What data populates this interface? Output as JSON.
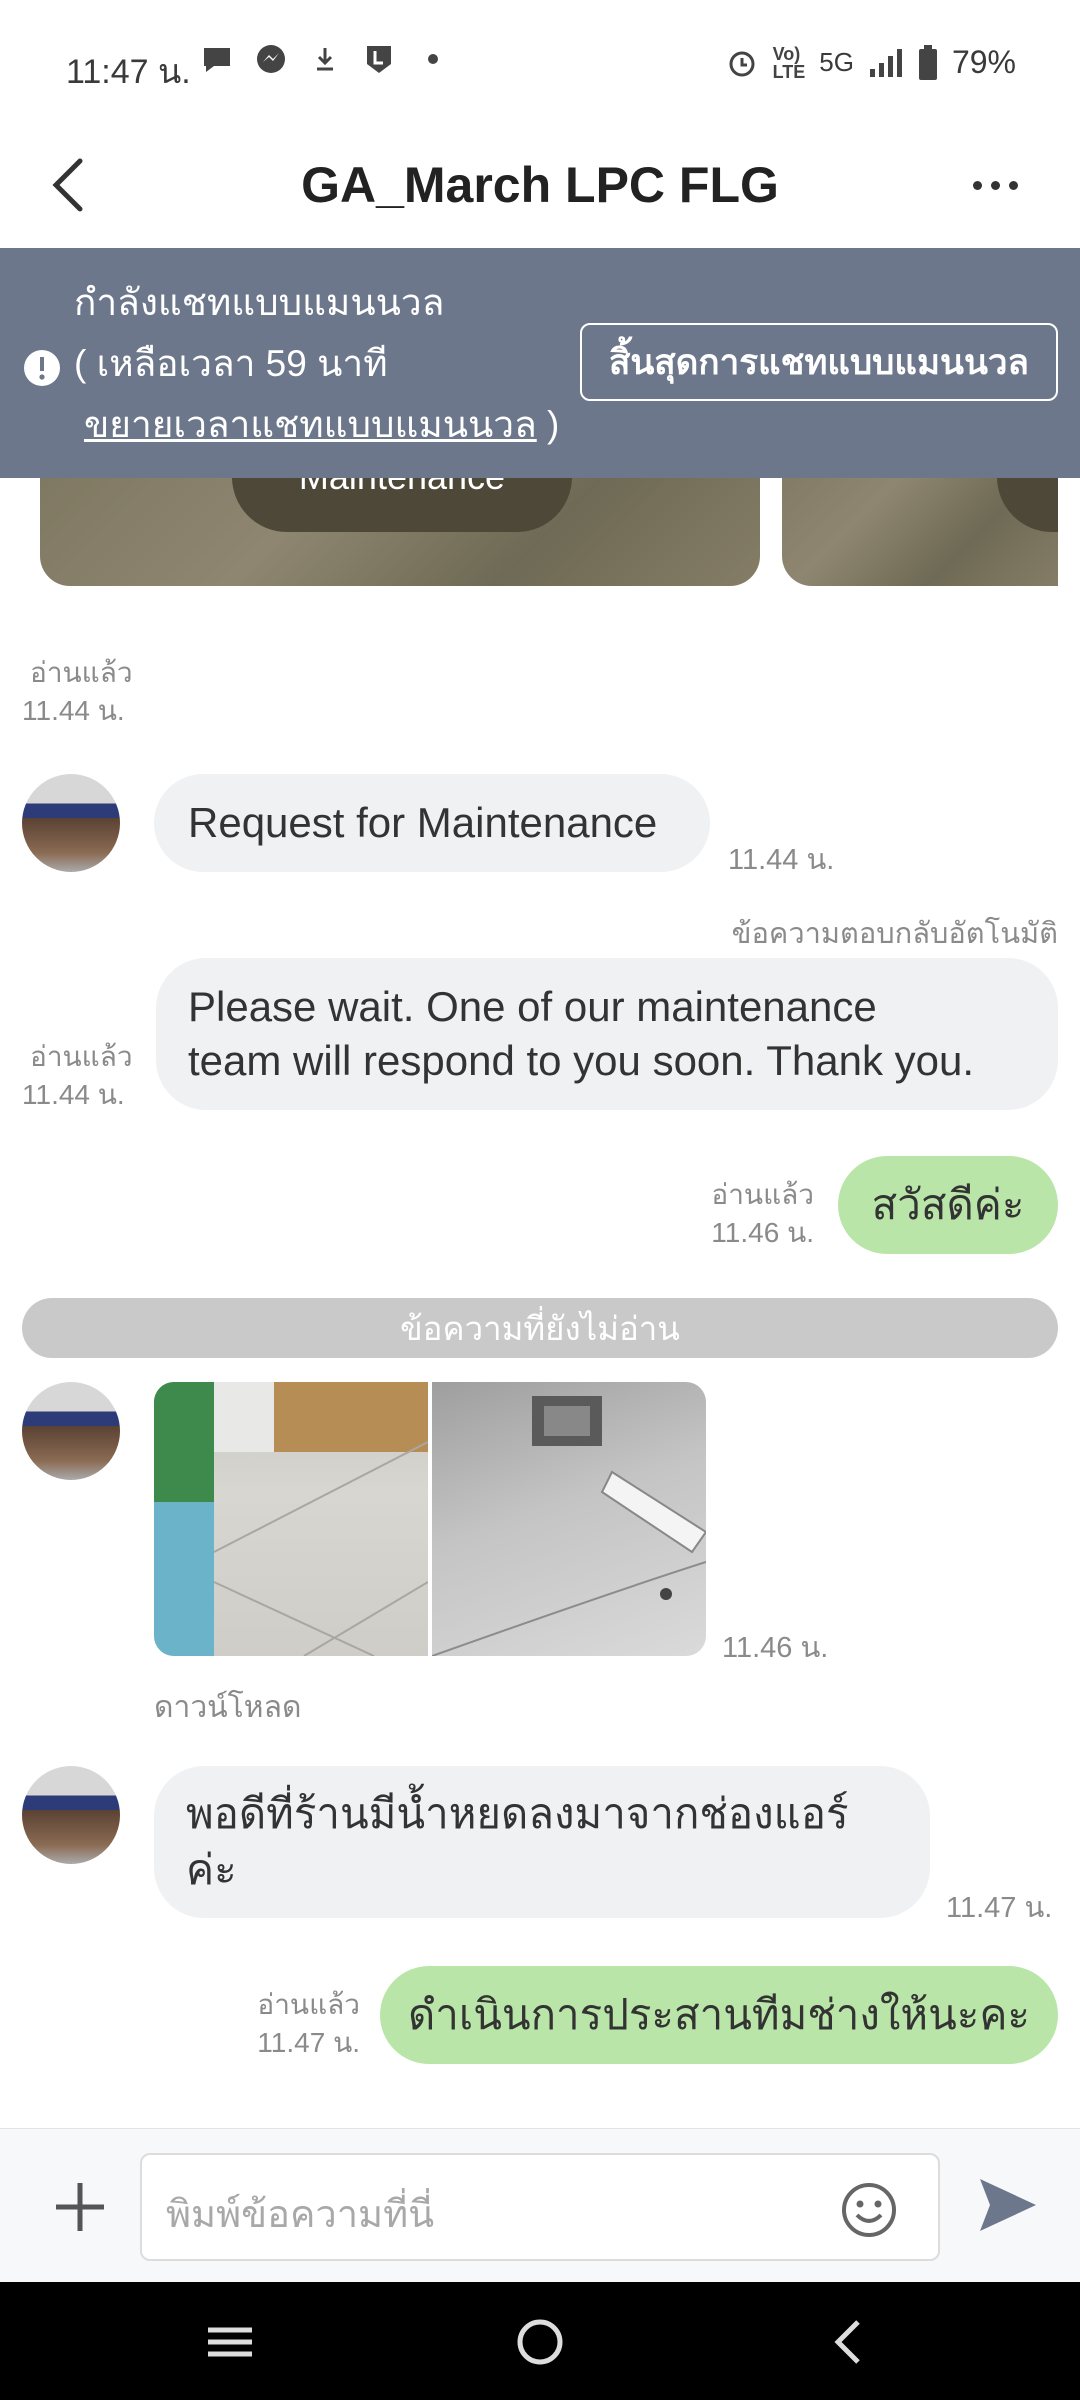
{
  "status_bar": {
    "time": "11:47 น.",
    "signal_text": "5G",
    "battery": "79%"
  },
  "header": {
    "title": "GA_March LPC FLG"
  },
  "banner": {
    "line1": "กำลังแชทแบบแมนนวล",
    "line2": "( เหลือเวลา 59 นาที",
    "link": "ขยายเวลาแชทแบบแมนนวล",
    "line3_suffix": " )",
    "end_button": "สิ้นสุดการแชทแบบแมนนวล"
  },
  "carousel": {
    "card_label": "Maintenance"
  },
  "messages": {
    "read1": {
      "label": "อ่านแล้ว",
      "time": "11.44 น."
    },
    "msg1": {
      "text": "Request for Maintenance",
      "time": "11.44 น."
    },
    "auto_reply_label": "ข้อความตอบกลับอัตโนมัติ",
    "msg2": {
      "line1": "Please wait.  One of our maintenance",
      "line2": "team will respond to you soon.  Thank you.",
      "read_label": "อ่านแล้ว",
      "time": "11.44 น."
    },
    "msg3": {
      "text": "สวัสดีค่ะ",
      "read_label": "อ่านแล้ว",
      "time": "11.46 น."
    },
    "unread_divider": "ข้อความที่ยังไม่อ่าน",
    "photos": {
      "time": "11.46 น.",
      "download_label": "ดาวน์โหลด"
    },
    "msg4": {
      "line1": "พอดีที่ร้านมีน้ำหยดลงมาจากช่องแอร์",
      "line2": "ค่ะ",
      "time": "11.47 น."
    },
    "msg5": {
      "text": "ดำเนินการประสานทีมช่างให้นะคะ",
      "read_label": "อ่านแล้ว",
      "time": "11.47 น."
    }
  },
  "input": {
    "placeholder": "พิมพ์ข้อความที่นี่"
  },
  "colors": {
    "banner": "#6d778b",
    "outgoing_bubble": "#b9e6a8",
    "incoming_bubble": "#f0f1f3"
  }
}
